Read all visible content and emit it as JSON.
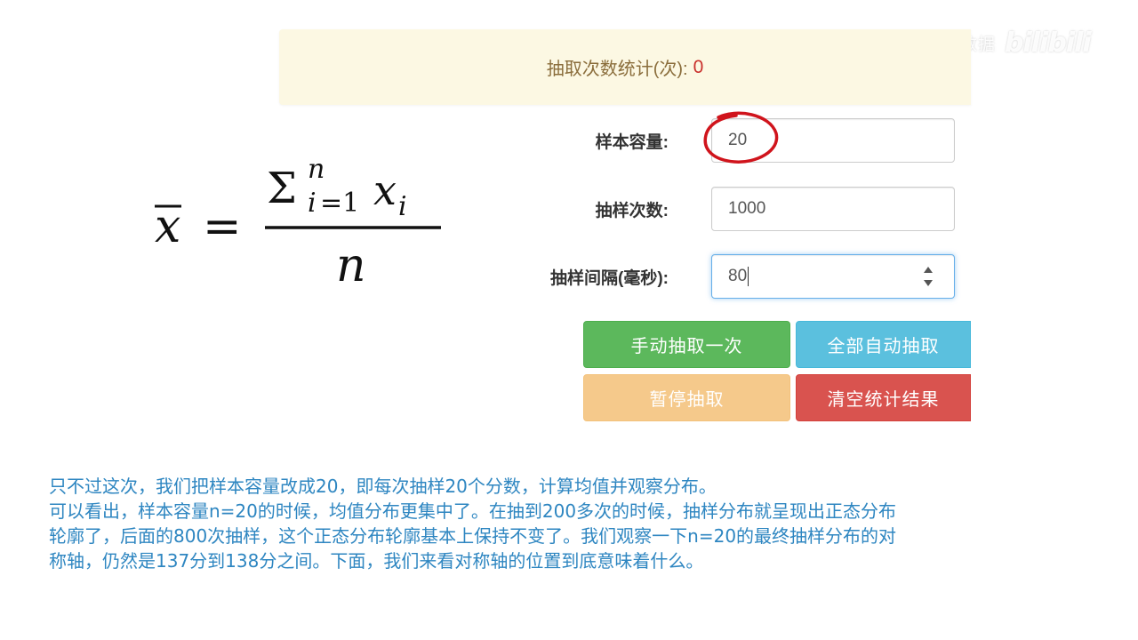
{
  "watermark": {
    "name": "大猫喵大数据",
    "logo": "bilibili"
  },
  "stats": {
    "label": "抽取次数统计(次):",
    "count": "0"
  },
  "formula": {
    "text": "x̄ = Σⁿᵢ₌₁ xᵢ / n"
  },
  "form": {
    "sample_size": {
      "label": "样本容量:",
      "value": "20"
    },
    "sample_times": {
      "label": "抽样次数:",
      "value": "1000"
    },
    "interval": {
      "label": "抽样间隔(毫秒):",
      "value": "80"
    }
  },
  "buttons": {
    "manual": "手动抽取一次",
    "auto_all": "全部自动抽取",
    "pause": "暂停抽取",
    "clear": "清空统计结果"
  },
  "colors": {
    "banner_bg": "#fcf8e3",
    "count_red": "#c9302c",
    "green": "#5cb85c",
    "blue": "#5bc0de",
    "orange": "#f0ad4e",
    "red": "#d9534f",
    "subtitle_blue": "#2e86c1"
  },
  "subtitles": {
    "line1": "只不过这次，我们把样本容量改成20，即每次抽样20个分数，计算均值并观察分布。",
    "line2": "可以看出，样本容量n=20的时候，均值分布更集中了。在抽到200多次的时候，抽样分布就呈现出正态分布",
    "line3": "轮廓了，后面的800次抽样，这个正态分布轮廓基本上保持不变了。我们观察一下n=20的最终抽样分布的对",
    "line4": "称轴，仍然是137分到138分之间。下面，我们来看对称轴的位置到底意味着什么。"
  }
}
